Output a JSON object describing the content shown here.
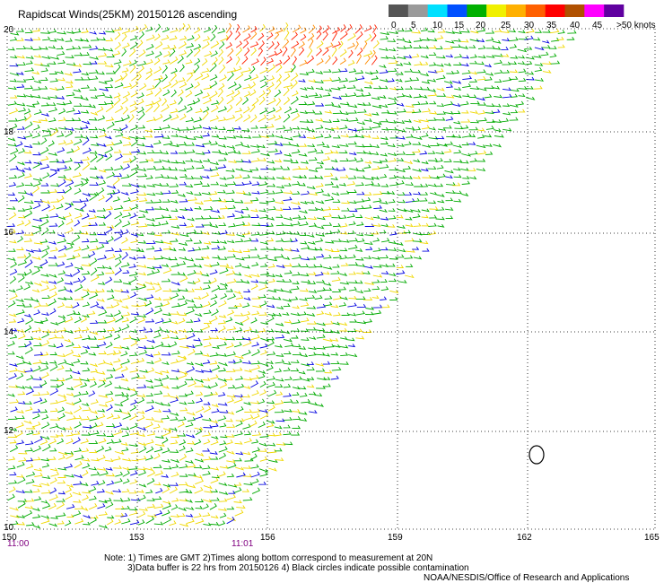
{
  "title": "Rapidscat Winds(25KM) 20150126 ascending",
  "colorbar": {
    "labels": [
      "0",
      "5",
      "10",
      "15",
      "20",
      "25",
      "30",
      "35",
      "40",
      "45",
      ">50 knots"
    ],
    "colors": [
      "#555555",
      "#9a9a9a",
      "#00e0ff",
      "#0050ff",
      "#00b000",
      "#f0f000",
      "#ffb000",
      "#ff6000",
      "#ff0000",
      "#b05000",
      "#ff00ff",
      "#6000a0"
    ]
  },
  "map": {
    "lat_labels": [
      "20",
      "18",
      "16",
      "14",
      "12",
      "10"
    ],
    "lon_labels": [
      "150",
      "153",
      "156",
      "159",
      "162",
      "165"
    ],
    "time_labels": [
      "11:00",
      "11:01"
    ],
    "time_color": "#800080"
  },
  "notes": [
    "Note: 1) Times are GMT 2)Times along bottom correspond to measurement at 20N",
    "3)Data buffer is 22 hrs from 20150126 4) Black circles indicate possible contamination",
    "NOAA/NESDIS/Office of Research and Applications"
  ]
}
